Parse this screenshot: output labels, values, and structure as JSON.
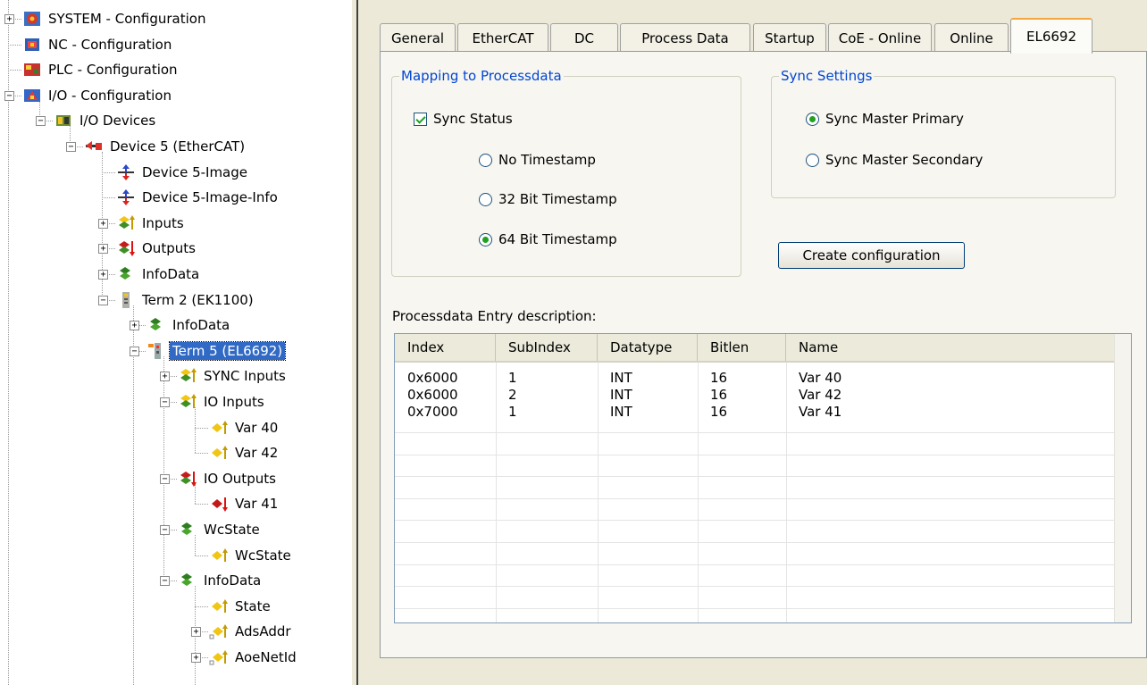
{
  "tree": {
    "nodes": [
      {
        "label": "SYSTEM - Configuration",
        "icon": "system-config-icon",
        "expander": "+"
      },
      {
        "label": "NC - Configuration",
        "icon": "nc-config-icon",
        "expander": ""
      },
      {
        "label": "PLC - Configuration",
        "icon": "plc-config-icon",
        "expander": ""
      },
      {
        "label": "I/O - Configuration",
        "icon": "io-config-icon",
        "expander": "−"
      },
      {
        "label": "I/O Devices",
        "icon": "io-devices-icon",
        "expander": "−"
      },
      {
        "label": "Device 5 (EtherCAT)",
        "icon": "ethercat-device-icon",
        "expander": "−"
      },
      {
        "label": "Device 5-Image",
        "icon": "image-icon",
        "expander": ""
      },
      {
        "label": "Device 5-Image-Info",
        "icon": "image-info-icon",
        "expander": ""
      },
      {
        "label": "Inputs",
        "icon": "inputs-icon",
        "expander": "+"
      },
      {
        "label": "Outputs",
        "icon": "outputs-icon",
        "expander": "+"
      },
      {
        "label": "InfoData",
        "icon": "infodata-icon",
        "expander": "+"
      },
      {
        "label": "Term 2 (EK1100)",
        "icon": "terminal-icon",
        "expander": "−"
      },
      {
        "label": "InfoData",
        "icon": "infodata-icon",
        "expander": "+"
      },
      {
        "label": "Term 5 (EL6692)",
        "icon": "terminal-el6692-icon",
        "expander": "−",
        "selected": true
      },
      {
        "label": "SYNC Inputs",
        "icon": "inputs-icon",
        "expander": "+"
      },
      {
        "label": "IO Inputs",
        "icon": "inputs-icon",
        "expander": "−"
      },
      {
        "label": "Var 40",
        "icon": "input-var-icon",
        "expander": ""
      },
      {
        "label": "Var 42",
        "icon": "input-var-icon",
        "expander": ""
      },
      {
        "label": "IO Outputs",
        "icon": "outputs-icon",
        "expander": "−"
      },
      {
        "label": "Var 41",
        "icon": "output-var-icon",
        "expander": ""
      },
      {
        "label": "WcState",
        "icon": "infodata-icon",
        "expander": "−"
      },
      {
        "label": "WcState",
        "icon": "input-var-icon",
        "expander": ""
      },
      {
        "label": "InfoData",
        "icon": "infodata-icon",
        "expander": "−"
      },
      {
        "label": "State",
        "icon": "input-var-icon",
        "expander": ""
      },
      {
        "label": "AdsAddr",
        "icon": "input-struct-icon",
        "expander": "+"
      },
      {
        "label": "AoeNetId",
        "icon": "input-struct-icon",
        "expander": "+"
      }
    ]
  },
  "tabs": [
    {
      "label": "General"
    },
    {
      "label": "EtherCAT"
    },
    {
      "label": "DC"
    },
    {
      "label": "Process Data"
    },
    {
      "label": "Startup"
    },
    {
      "label": "CoE - Online"
    },
    {
      "label": "Online"
    },
    {
      "label": "EL6692",
      "active": true
    }
  ],
  "mapping": {
    "title": "Mapping to Processdata",
    "sync_status": {
      "label": "Sync Status",
      "checked": true
    },
    "timestamp_options": [
      {
        "label": "No Timestamp",
        "selected": false
      },
      {
        "label": "32 Bit Timestamp",
        "selected": false
      },
      {
        "label": "64 Bit Timestamp",
        "selected": true
      }
    ]
  },
  "sync_settings": {
    "title": "Sync Settings",
    "options": [
      {
        "label": "Sync Master Primary",
        "selected": true
      },
      {
        "label": "Sync Master Secondary",
        "selected": false
      }
    ]
  },
  "create_button": "Create configuration",
  "processdata": {
    "label": "Processdata Entry description:",
    "columns": [
      "Index",
      "SubIndex",
      "Datatype",
      "Bitlen",
      "Name"
    ],
    "rows": [
      [
        "0x6000",
        "1",
        "INT",
        "16",
        "Var 40"
      ],
      [
        "0x6000",
        "2",
        "INT",
        "16",
        "Var 42"
      ],
      [
        "0x7000",
        "1",
        "INT",
        "16",
        "Var 41"
      ]
    ]
  },
  "colors": {
    "group_title": "#0046d5",
    "selection": "#316ac5",
    "active_tab_accent": "#f4a640",
    "panel_bg": "#ece9d8"
  }
}
